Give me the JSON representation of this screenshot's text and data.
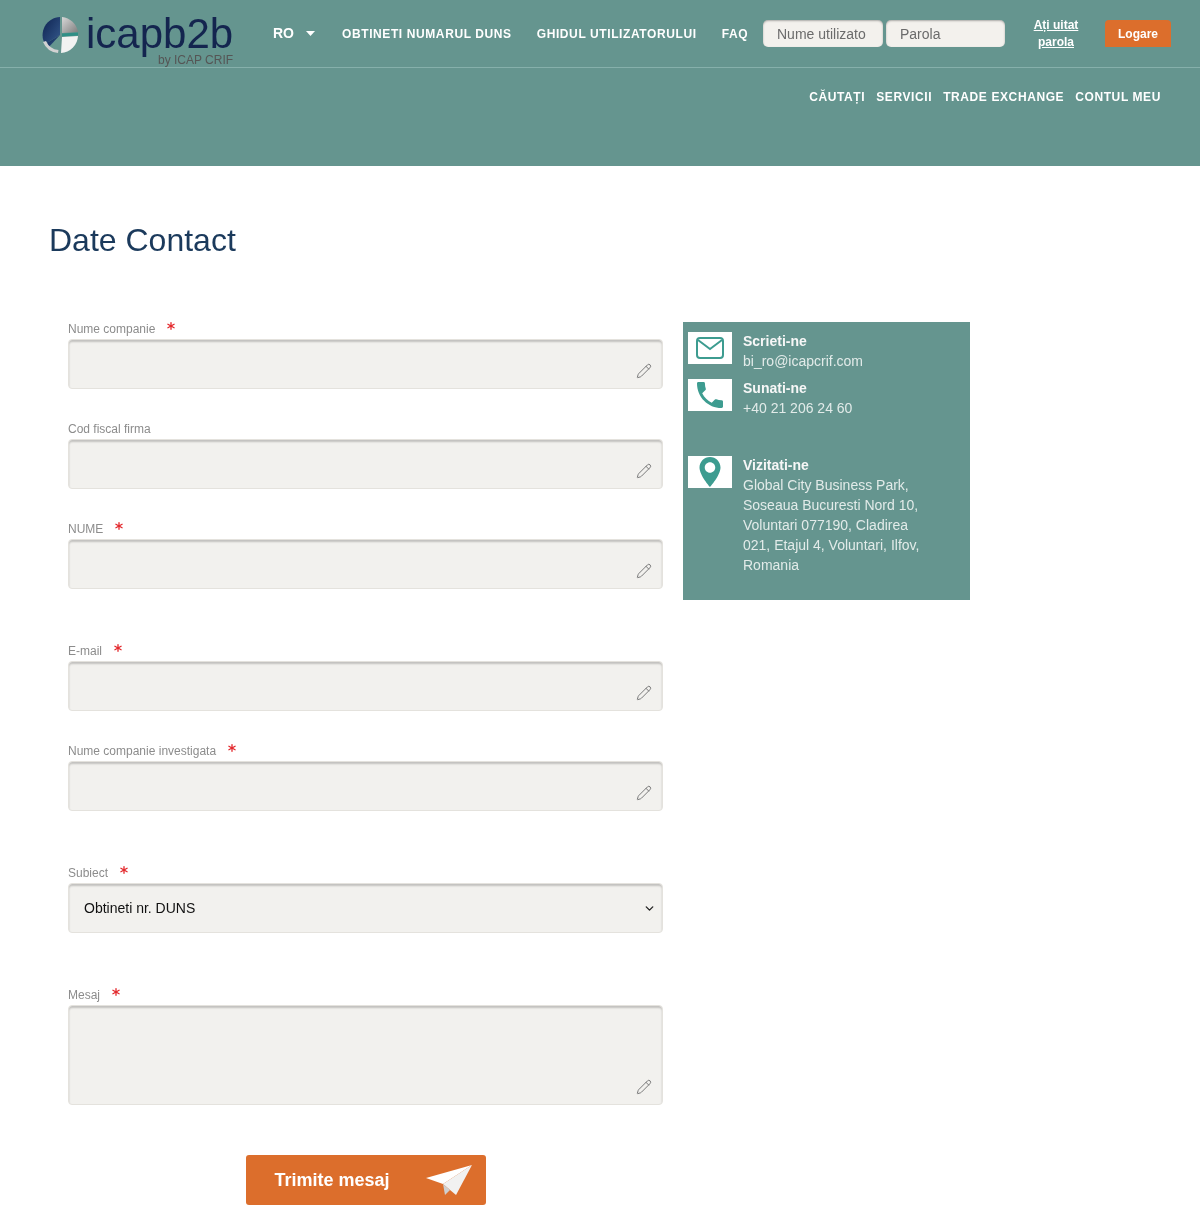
{
  "header": {
    "logo": {
      "wordmark": "icapb2b",
      "tagline": "by ICAP CRIF"
    },
    "language": "RO",
    "top_links": [
      "OBTINETI NUMARUL DUNS",
      "GHIDUL UTILIZATORULUI",
      "FAQ"
    ],
    "login": {
      "username": {
        "placeholder": "Nume utilizato"
      },
      "password": {
        "placeholder": "Parola"
      },
      "forgot_link": "Ați uitat parola",
      "button": "Logare"
    },
    "main_nav": [
      "CĂUTAȚI",
      "SERVICII",
      "TRADE EXCHANGE",
      "CONTUL MEU"
    ]
  },
  "page_title": "Date Contact",
  "form": {
    "fields": [
      {
        "label": "Nume companie",
        "required": true,
        "kind": "text"
      },
      {
        "label": "Cod fiscal firma",
        "required": false,
        "kind": "text"
      },
      {
        "label": "NUME",
        "required": true,
        "kind": "text"
      },
      {
        "label": "E-mail",
        "required": true,
        "kind": "text"
      },
      {
        "label": "Nume companie investigata",
        "required": true,
        "kind": "text"
      },
      {
        "label": "Subiect",
        "required": true,
        "kind": "select",
        "value": "Obtineti nr. DUNS"
      },
      {
        "label": "Mesaj",
        "required": true,
        "kind": "textarea"
      }
    ],
    "submit": "Trimite mesaj"
  },
  "contact": {
    "items": [
      {
        "kind": "email",
        "title": "Scrieti-ne",
        "text": "bi_ro@icapcrif.com"
      },
      {
        "kind": "phone",
        "title": "Sunati-ne",
        "text": "+40 21 206 24 60"
      },
      {
        "kind": "address",
        "title": "Vizitati-ne",
        "text": "Global City Business Park, Soseaua Bucuresti Nord 10, Voluntari 077190, Cladirea 021, Etajul 4, Voluntari, Ilfov, Romania"
      }
    ]
  }
}
